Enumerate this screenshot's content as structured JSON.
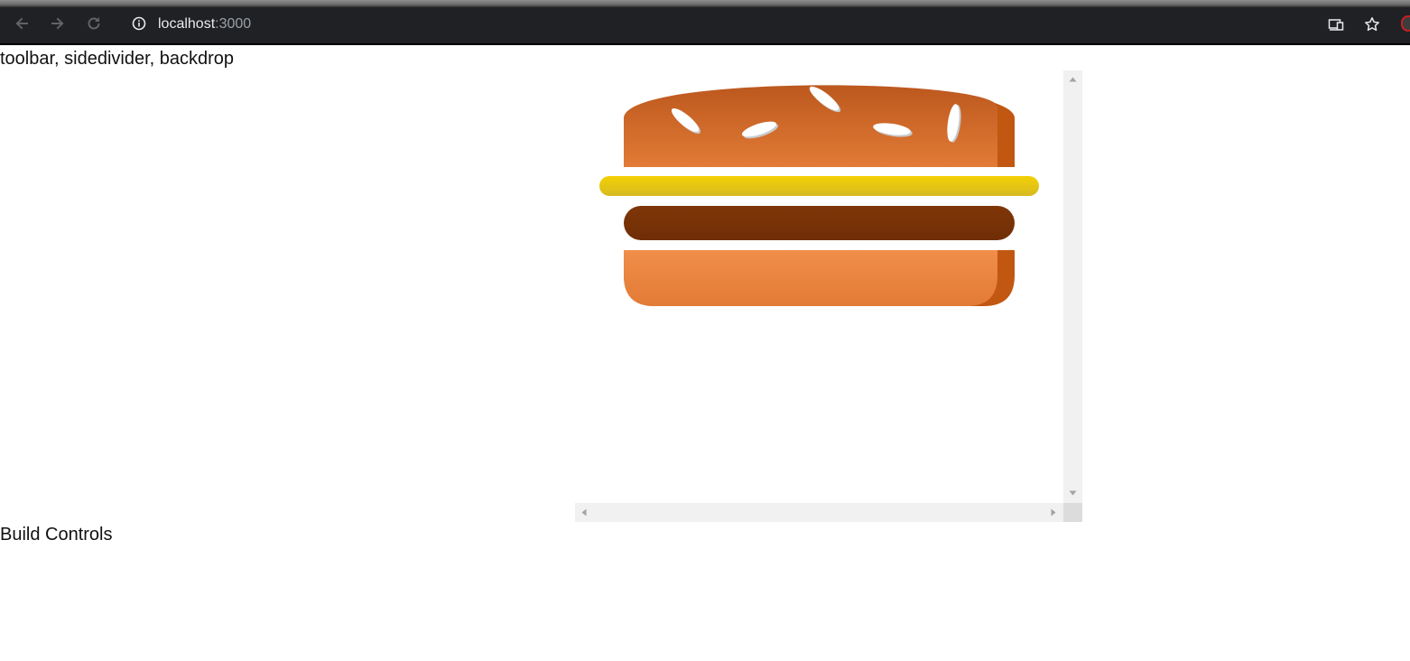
{
  "browser": {
    "url_host": "localhost",
    "url_port": ":3000"
  },
  "page": {
    "top_label": "toolbar, sidedivider, backdrop",
    "bottom_label": "Build Controls"
  },
  "burger": {
    "ingredients": [
      "bread-top",
      "cheese",
      "meat",
      "bread-bottom"
    ],
    "colors": {
      "bun_top": "#e27b36",
      "bun_top_dark": "#c15711",
      "cheese": "#e9c70f",
      "meat": "#7b300b",
      "bun_bottom": "#f08e4a",
      "seed": "#ffffff"
    }
  },
  "icons": {
    "back": "arrow-left-icon",
    "forward": "arrow-right-icon",
    "reload": "reload-icon",
    "info": "info-icon",
    "cast": "cast-icon",
    "bookmark": "star-icon"
  }
}
